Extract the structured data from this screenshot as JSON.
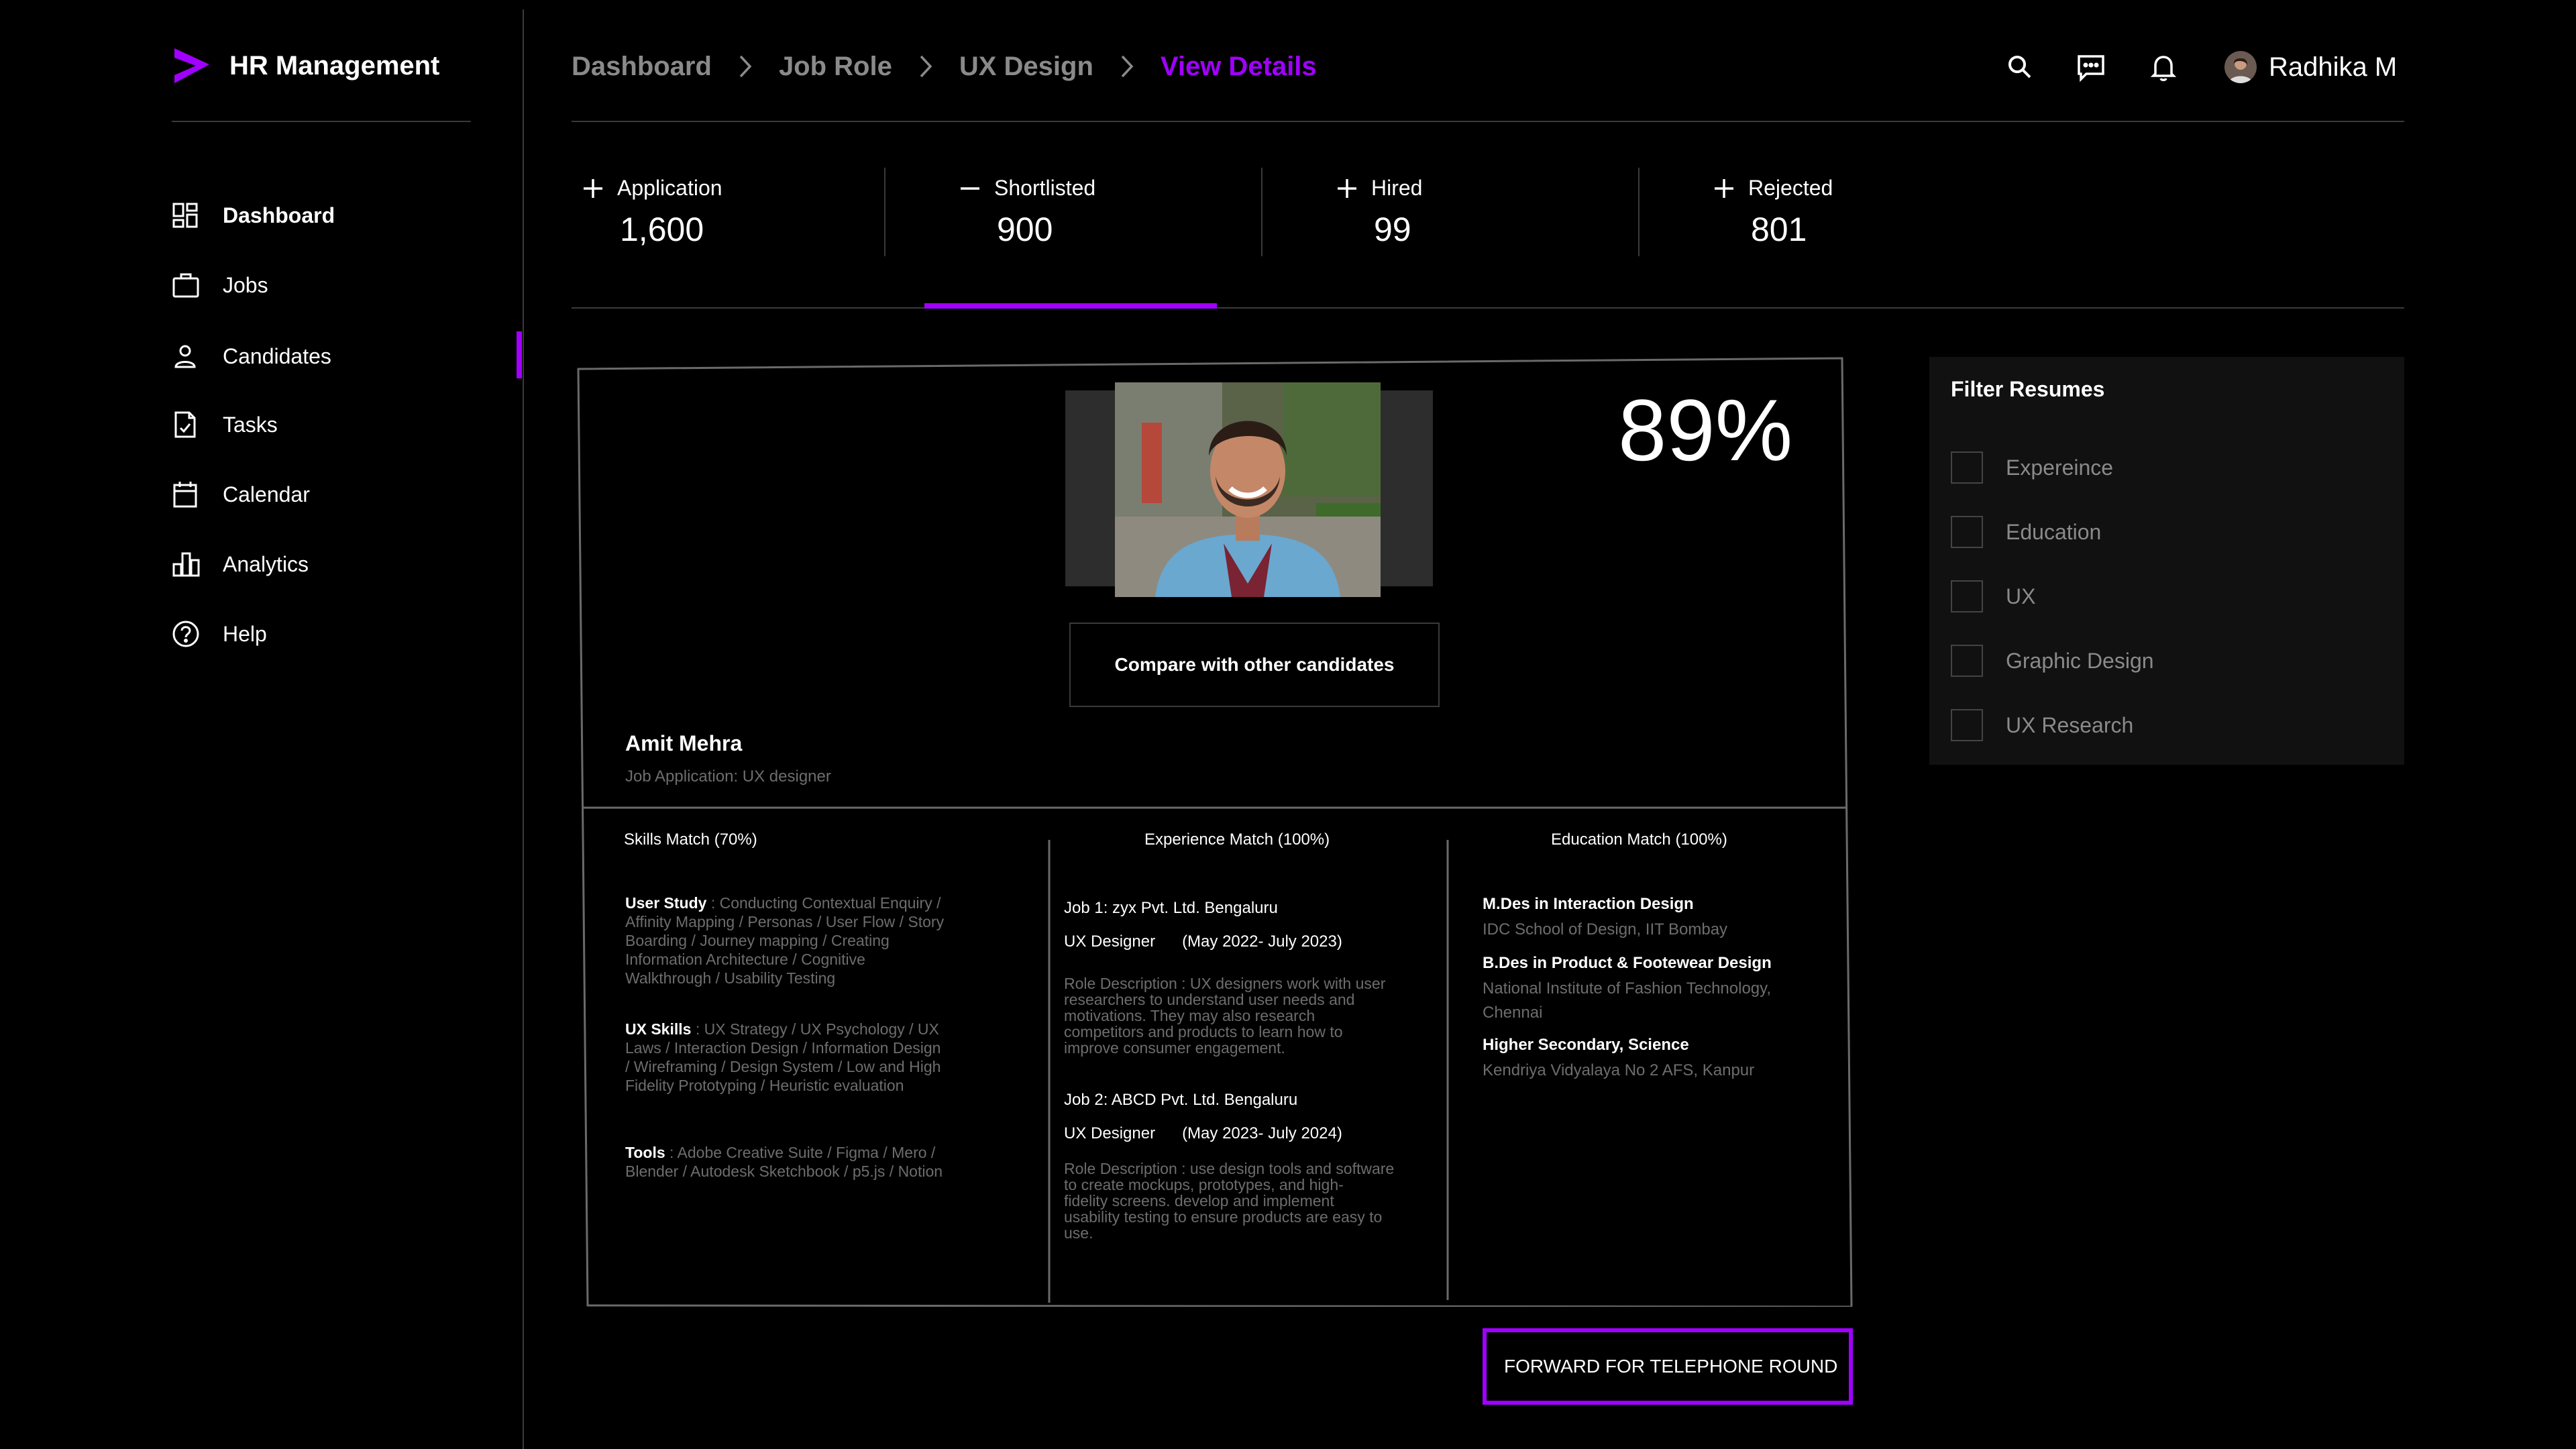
{
  "app": {
    "title": "HR Management"
  },
  "sidebar": {
    "items": [
      {
        "label": "Dashboard",
        "icon": "dashboard-icon"
      },
      {
        "label": "Jobs",
        "icon": "briefcase-icon"
      },
      {
        "label": "Candidates",
        "icon": "user-icon"
      },
      {
        "label": "Tasks",
        "icon": "task-file-icon"
      },
      {
        "label": "Calendar",
        "icon": "calendar-icon"
      },
      {
        "label": "Analytics",
        "icon": "bar-chart-icon"
      },
      {
        "label": "Help",
        "icon": "help-icon"
      }
    ]
  },
  "breadcrumb": [
    "Dashboard",
    "Job Role",
    "UX Design",
    "View Details"
  ],
  "user": {
    "name": "Radhika M"
  },
  "stats": [
    {
      "sign": "+",
      "label": "Application",
      "value": "1,600"
    },
    {
      "sign": "−",
      "label": "Shortlisted",
      "value": "900"
    },
    {
      "sign": "+",
      "label": "Hired",
      "value": "99"
    },
    {
      "sign": "+",
      "label": "Rejected",
      "value": "801"
    }
  ],
  "candidate": {
    "name": "Amit Mehra",
    "subtitle": "Job Application: UX designer",
    "match": "89%",
    "compare_label": "Compare with other candidates"
  },
  "skills": {
    "heading": "Skills Match (70%)",
    "groups": [
      {
        "title": "User Study",
        "items": [
          " : Conducting Contextual Enquiry /",
          "Affinity Mapping /  Personas / User Flow / Story",
          "Boarding / Journey mapping /  Creating",
          "Information Architecture / Cognitive",
          "Walkthrough / Usability Testing"
        ]
      },
      {
        "title": "UX Skills",
        "items": [
          " : UX Strategy / UX Psychology  / UX",
          "Laws /  Interaction Design / Information Design",
          "/  Wireframing / Design System / Low and High",
          "Fidelity Prototyping / Heuristic evaluation"
        ]
      },
      {
        "title": "Tools",
        "items": [
          " : Adobe  Creative Suite / Figma / Mero /",
          "Blender /  Autodesk Sketchbook / p5.js / Notion"
        ]
      }
    ]
  },
  "experience": {
    "heading": "Experience Match (100%)",
    "jobs": [
      {
        "company": "Job 1: zyx  Pvt. Ltd. Bengaluru",
        "role": "UX Designer      (May 2022- July 2023)",
        "desc": [
          "Role Description : UX designers work with user",
          "researchers to understand user needs and",
          "motivations. They may also research",
          "competitors and products to learn how to",
          "improve consumer engagement."
        ]
      },
      {
        "company": "Job 2: ABCD  Pvt. Ltd. Bengaluru",
        "role": "UX Designer      (May 2023- July 2024)",
        "desc": [
          "Role Description : use design tools and software",
          "to create mockups, prototypes, and high-",
          "fidelity screens. develop and implement",
          "usability testing to ensure products are easy to",
          "use."
        ]
      }
    ]
  },
  "education": {
    "heading": "Education Match (100%)",
    "entries": [
      {
        "degree": "M.Des in  Interaction Design",
        "inst": [
          "IDC School of Design, IIT Bombay"
        ]
      },
      {
        "degree": "B.Des in Product & Footewear Design",
        "inst": [
          "National Institute of Fashion Technology,",
          "Chennai"
        ]
      },
      {
        "degree": "Higher Secondary, Science",
        "inst": [
          "Kendriya Vidyalaya No 2 AFS, Kanpur"
        ]
      }
    ]
  },
  "forward": {
    "label": "FORWARD FOR TELEPHONE ROUND"
  },
  "filter": {
    "title": "Filter Resumes",
    "options": [
      "Expereince",
      "Education",
      "UX",
      "Graphic Design",
      "UX Research"
    ]
  },
  "colors": {
    "accent": "#a100ff",
    "background": "#000000",
    "muted": "#8a8a8a",
    "divider": "#3a3a3a"
  }
}
